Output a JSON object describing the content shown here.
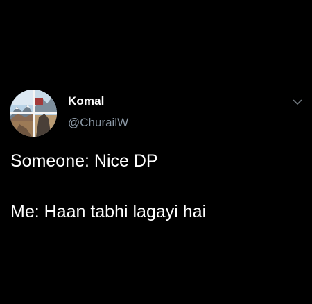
{
  "tweet": {
    "author": {
      "display_name": "Komal",
      "handle": "@ChurailW",
      "avatar_icon": "profile-photo-collage"
    },
    "more_icon": "chevron-down-icon",
    "text_lines": [
      "Someone: Nice DP",
      "Me: Haan tabhi lagayi hai"
    ]
  },
  "colors": {
    "background": "#000000",
    "primary_text": "#ffffff",
    "secondary_text": "#8b98a5"
  }
}
